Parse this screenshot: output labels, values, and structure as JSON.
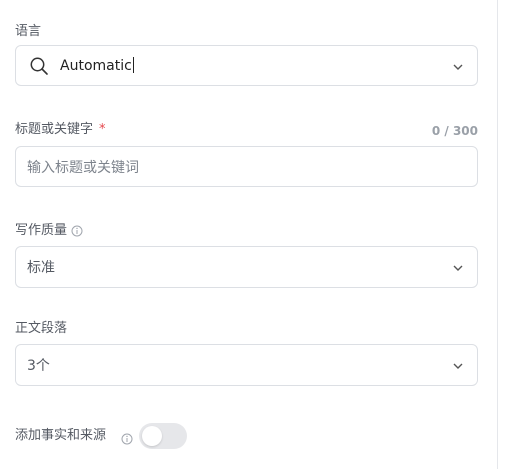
{
  "form": {
    "language": {
      "label": "语言",
      "value": "Automatic",
      "icon": "search-icon",
      "chevron_icon": "chevron-down-icon"
    },
    "title_keywords": {
      "label": "标题或关键字",
      "required_mark": "*",
      "counter": "0 / 300",
      "placeholder": "输入标题或关键词",
      "value": ""
    },
    "writing_quality": {
      "label": "写作质量",
      "info_icon": "info-icon",
      "value": "标准",
      "chevron_icon": "chevron-down-icon"
    },
    "body_paragraphs": {
      "label": "正文段落",
      "value": "3个",
      "chevron_icon": "chevron-down-icon"
    },
    "facts_sources": {
      "label": "添加事实和来源",
      "info_icon": "info-icon",
      "enabled": false
    }
  },
  "colors": {
    "border": "#dcdfe4",
    "label_text": "#555a63",
    "required": "#e5484d",
    "toggle_off": "#e6e7ea"
  }
}
